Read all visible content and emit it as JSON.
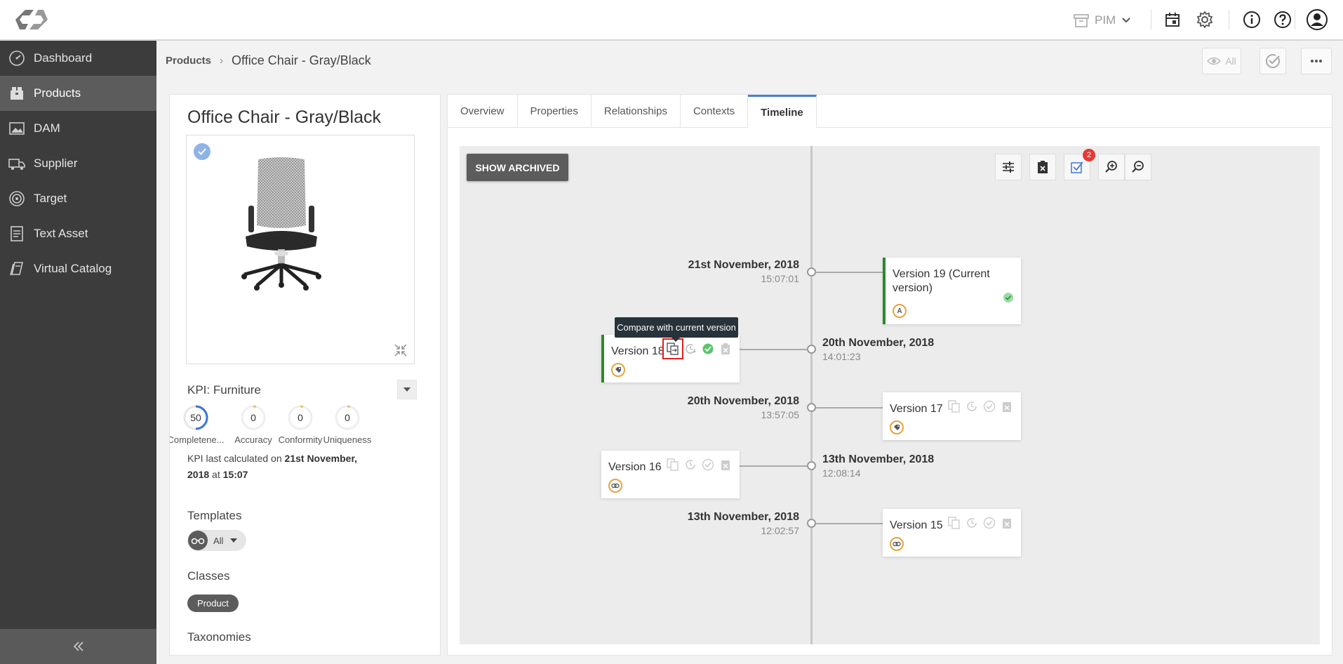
{
  "topbar": {
    "workspace_label": "PIM",
    "icons": [
      "calendar-icon",
      "gear-icon",
      "info-icon",
      "help-icon",
      "user-icon"
    ]
  },
  "sidebar": {
    "items": [
      {
        "label": "Dashboard",
        "icon": "speedometer-icon"
      },
      {
        "label": "Products",
        "icon": "box-icon",
        "active": true
      },
      {
        "label": "DAM",
        "icon": "image-icon"
      },
      {
        "label": "Supplier",
        "icon": "truck-icon"
      },
      {
        "label": "Target",
        "icon": "target-icon"
      },
      {
        "label": "Text Asset",
        "icon": "document-icon"
      },
      {
        "label": "Virtual Catalog",
        "icon": "catalog-icon"
      }
    ]
  },
  "breadcrumb": {
    "root": "Products",
    "current": "Office Chair - Gray/Black"
  },
  "header": {
    "view_all_label": "All"
  },
  "product": {
    "title": "Office Chair - Gray/Black",
    "kpi": {
      "label": "KPI:",
      "value": "Furniture",
      "metrics": [
        {
          "label": "Completene...",
          "value": "50"
        },
        {
          "label": "Accuracy",
          "value": "0"
        },
        {
          "label": "Conformity",
          "value": "0"
        },
        {
          "label": "Uniqueness",
          "value": "0"
        }
      ],
      "note_prefix": "KPI last calculated on",
      "note_date": "21st November, 2018",
      "note_at": "at",
      "note_time": "15:07"
    },
    "templates_label": "Templates",
    "templates_value": "All",
    "classes_label": "Classes",
    "class_chip": "Product",
    "taxonomies_label": "Taxonomies"
  },
  "tabs": [
    "Overview",
    "Properties",
    "Relationships",
    "Contexts",
    "Timeline"
  ],
  "active_tab": "Timeline",
  "timeline": {
    "show_archived_label": "SHOW ARCHIVED",
    "notification_count": "2",
    "tooltip": "Compare with current version",
    "entries": [
      {
        "date": "21st November, 2018",
        "time": "15:07:01",
        "version": "Version 19 (Current version)",
        "tag": "A"
      },
      {
        "date": "20th November, 2018",
        "time": "14:01:23",
        "version": "Version 18",
        "tag": "tag"
      },
      {
        "date": "20th November, 2018",
        "time": "13:57:05",
        "version": "Version 17",
        "tag": "tag"
      },
      {
        "date": "13th November, 2018",
        "time": "12:08:14",
        "version": "Version 16",
        "tag": "link"
      },
      {
        "date": "13th November, 2018",
        "time": "12:02:57",
        "version": "Version 15",
        "tag": "link"
      }
    ]
  },
  "colors": {
    "sidebar_bg": "#3c3c3c",
    "sidebar_active": "#5c5c5c",
    "accent_blue": "#4a7ed8",
    "current_green": "#2a8a2a",
    "highlight_red": "#e02020"
  }
}
